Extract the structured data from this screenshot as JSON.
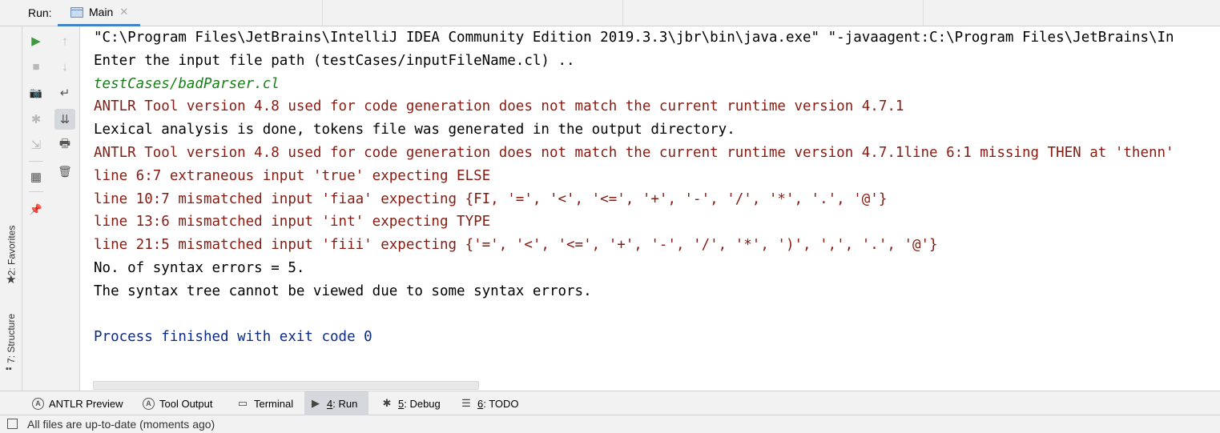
{
  "header": {
    "run_label": "Run:",
    "tab_title": "Main",
    "tab_close": "✕"
  },
  "left_strip": {
    "favorites_label": "2: Favorites",
    "structure_label": "7: Structure"
  },
  "toolbar": {
    "run_icon": "▶",
    "stop_icon": "■",
    "camera_icon": "📷",
    "debug_icon": "✱",
    "restore_icon": "⇲",
    "layout_icon": "▦",
    "pin_icon": "📌",
    "up_icon": "↑",
    "down_icon": "↓",
    "wrap_icon": "↵",
    "scroll_end_icon": "⇊",
    "print_icon": "🖶",
    "trash_icon": "🗑"
  },
  "console": {
    "lines": [
      {
        "type": "normal",
        "text": "\"C:\\Program Files\\JetBrains\\IntelliJ IDEA Community Edition 2019.3.3\\jbr\\bin\\java.exe\" \"-javaagent:C:\\Program Files\\JetBrains\\In"
      },
      {
        "type": "normal",
        "text": "Enter the input file path (testCases/inputFileName.cl) .."
      },
      {
        "type": "input",
        "text": "testCases/badParser.cl"
      },
      {
        "type": "error",
        "text": "ANTLR Tool version 4.8 used for code generation does not match the current runtime version 4.7.1"
      },
      {
        "type": "normal",
        "text": "Lexical analysis is done, tokens file was generated in the output directory."
      },
      {
        "type": "error",
        "text": "ANTLR Tool version 4.8 used for code generation does not match the current runtime version 4.7.1line 6:1 missing THEN at 'thenn'"
      },
      {
        "type": "error",
        "text": "line 6:7 extraneous input 'true' expecting ELSE"
      },
      {
        "type": "error",
        "text": "line 10:7 mismatched input 'fiaa' expecting {FI, '=', '<', '<=', '+', '-', '/', '*', '.', '@'}"
      },
      {
        "type": "error",
        "text": "line 13:6 mismatched input 'int' expecting TYPE"
      },
      {
        "type": "error",
        "text": "line 21:5 mismatched input 'fiii' expecting {'=', '<', '<=', '+', '-', '/', '*', ')', ',', '.', '@'}"
      },
      {
        "type": "normal",
        "text": "No. of syntax errors = 5."
      },
      {
        "type": "normal",
        "text": "The syntax tree cannot be viewed due to some syntax errors."
      },
      {
        "type": "blank",
        "text": ""
      },
      {
        "type": "system",
        "text": "Process finished with exit code 0"
      }
    ]
  },
  "bottom_bar": {
    "items": [
      {
        "prefix": "",
        "label": "ANTLR Preview"
      },
      {
        "prefix": "",
        "label": "Tool Output"
      },
      {
        "prefix": "",
        "label": "Terminal"
      },
      {
        "prefix": "4",
        "label": ": Run"
      },
      {
        "prefix": "5",
        "label": ": Debug"
      },
      {
        "prefix": "6",
        "label": ": TODO"
      }
    ]
  },
  "status_bar": {
    "text": "All files are up-to-date (moments ago)"
  },
  "colors": {
    "normal": "#000000",
    "error": "#871b11",
    "input": "#148214",
    "system": "#0c2b87",
    "run_green": "#3e9b3e",
    "tab_underline": "#4083c9"
  }
}
